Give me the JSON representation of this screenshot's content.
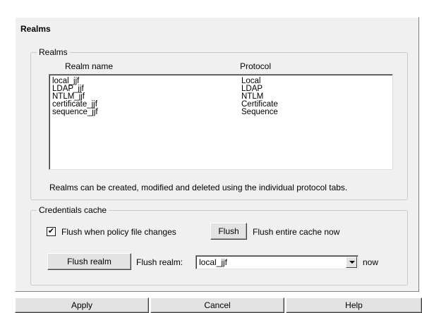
{
  "panel": {
    "title": "Realms"
  },
  "realms_group": {
    "legend": "Realms",
    "column_headers": [
      "Realm name",
      "Protocol"
    ],
    "rows": [
      {
        "name": "local_jjf",
        "protocol": "Local"
      },
      {
        "name": "LDAP_jjf",
        "protocol": "LDAP"
      },
      {
        "name": "NTLM_jjf",
        "protocol": "NTLM"
      },
      {
        "name": "certificate_jjf",
        "protocol": "Certificate"
      },
      {
        "name": "sequence_jjf",
        "protocol": "Sequence"
      }
    ],
    "note": "Realms can be created, modified and deleted using the individual protocol tabs."
  },
  "credentials_group": {
    "legend": "Credentials cache",
    "flush_on_change": {
      "label": "Flush when policy file changes",
      "checked": true,
      "check_glyph": "✔"
    },
    "flush_button": "Flush",
    "flush_desc": "Flush entire cache now",
    "flush_realm_button": "Flush realm",
    "flush_realm_label": "Flush realm:",
    "realm_select_value": "local_jjf",
    "now_label": "now"
  },
  "footer": {
    "apply": "Apply",
    "cancel": "Cancel",
    "help": "Help"
  }
}
